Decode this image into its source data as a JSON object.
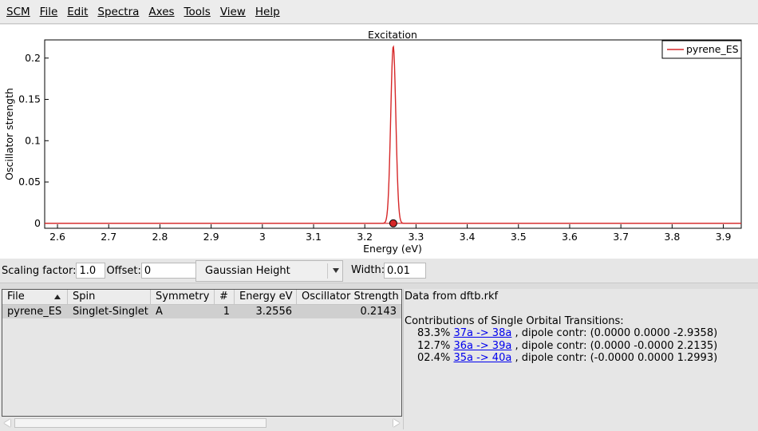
{
  "menubar": {
    "items": [
      {
        "label": "SCM",
        "name": "menu-scm"
      },
      {
        "label": "File",
        "name": "menu-file"
      },
      {
        "label": "Edit",
        "name": "menu-edit"
      },
      {
        "label": "Spectra",
        "name": "menu-spectra"
      },
      {
        "label": "Axes",
        "name": "menu-axes"
      },
      {
        "label": "Tools",
        "name": "menu-tools"
      },
      {
        "label": "View",
        "name": "menu-view"
      },
      {
        "label": "Help",
        "name": "menu-help"
      }
    ]
  },
  "chart_data": {
    "type": "line",
    "title": "Excitation",
    "xlabel": "Energy (eV)",
    "ylabel": "Oscillator strength",
    "xlim": [
      2.575,
      3.935
    ],
    "ylim": [
      -0.006,
      0.222
    ],
    "xticks": [
      "2.6",
      "2.7",
      "2.8",
      "2.9",
      "3",
      "3.1",
      "3.2",
      "3.3",
      "3.4",
      "3.5",
      "3.6",
      "3.7",
      "3.8",
      "3.9"
    ],
    "yticks": [
      "0",
      "0.05",
      "0.1",
      "0.15",
      "0.2"
    ],
    "legend_position": "top-right",
    "series": [
      {
        "name": "pyrene_ES",
        "color": "#d62728",
        "peak_x": 3.2556,
        "peak_y": 0.2143,
        "gaussian_sigma": 0.005,
        "marker": {
          "x": 3.2556,
          "y": 0
        }
      }
    ]
  },
  "controls": {
    "scaling_label": "Scaling factor:",
    "scaling_value": "1.0",
    "offset_label": "Offset:",
    "offset_value": "0",
    "broadening": "Gaussian Height",
    "width_label": "Width:",
    "width_value": "0.01"
  },
  "table": {
    "columns": [
      "File",
      "Spin",
      "Symmetry",
      "#",
      "Energy eV",
      "Oscillator Strength"
    ],
    "rows": [
      {
        "file": "pyrene_ES",
        "spin": "Singlet-Singlet",
        "symmetry": "A",
        "num": "1",
        "energy": "3.2556",
        "strength": "0.2143"
      }
    ]
  },
  "info": {
    "source": "Data from dftb.rkf",
    "heading": "Contributions of Single Orbital Transitions:",
    "contributions": [
      {
        "pct": "83.3%",
        "link": "37a -> 38a",
        "rest": ", dipole contr: (0.0000 0.0000 -2.9358)"
      },
      {
        "pct": "12.7%",
        "link": "36a -> 39a",
        "rest": ", dipole contr: (0.0000 -0.0000 2.2135)"
      },
      {
        "pct": "02.4%",
        "link": "35a -> 40a",
        "rest": ", dipole contr: (-0.0000 0.0000 1.2993)"
      }
    ]
  }
}
